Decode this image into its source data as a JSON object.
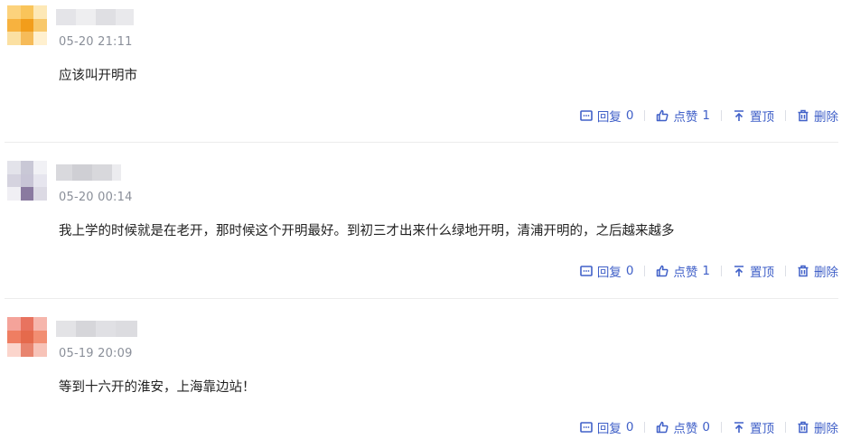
{
  "colors": {
    "accent": "#4060c8",
    "divider": "#ececec"
  },
  "comments": [
    {
      "avatar_colors": [
        "#fcd27c",
        "#f9c45a",
        "#fde8b6",
        "#f7b23f",
        "#f29d1b",
        "#f8c86b",
        "#fbe0a2",
        "#f6bb59",
        "#fff0cf"
      ],
      "date": "05-20 21:11",
      "text": "应该叫开明市",
      "reply_label": "回复",
      "reply_count": "0",
      "like_label": "点赞",
      "like_count": "1",
      "pin_label": "置顶",
      "delete_label": "删除"
    },
    {
      "avatar_colors": [
        "#e3e3ea",
        "#c9c8d6",
        "#f1f1f5",
        "#d5d3df",
        "#c8c5d6",
        "#e6e5ee",
        "#f0eff4",
        "#8a7aa0",
        "#dcdae4"
      ],
      "date": "05-20 00:14",
      "text": "我上学的时候就是在老开，那时候这个开明最好。到初三才出来什么绿地开明，清浦开明的，之后越来越多",
      "reply_label": "回复",
      "reply_count": "0",
      "like_label": "点赞",
      "like_count": "1",
      "pin_label": "置顶",
      "delete_label": "删除"
    },
    {
      "avatar_colors": [
        "#f4a39a",
        "#e8735f",
        "#f6b6ac",
        "#ef7e62",
        "#e56a4c",
        "#f28e72",
        "#fbd5cc",
        "#e8846e",
        "#f7c3b8"
      ],
      "date": "05-19 20:09",
      "text": "等到十六开的淮安，上海靠边站！",
      "reply_label": "回复",
      "reply_count": "0",
      "like_label": "点赞",
      "like_count": "0",
      "pin_label": "置顶",
      "delete_label": "删除"
    }
  ]
}
